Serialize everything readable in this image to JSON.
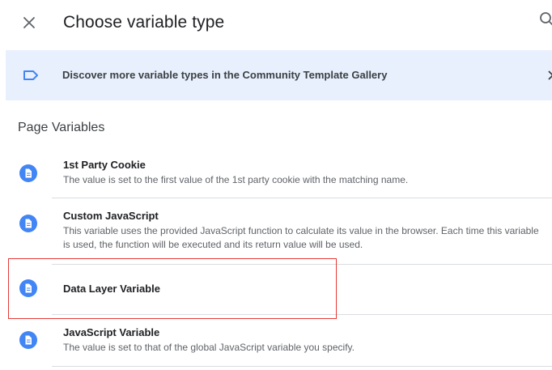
{
  "header": {
    "title": "Choose variable type",
    "close_icon": "close-icon",
    "search_icon": "search-icon"
  },
  "banner": {
    "text": "Discover more variable types in the Community Template Gallery",
    "icon": "tag-icon",
    "chevron_icon": "chevron-right-icon"
  },
  "section": {
    "heading": "Page Variables"
  },
  "items": [
    {
      "name": "1st Party Cookie",
      "description": "The value is set to the first value of the 1st party cookie with the matching name."
    },
    {
      "name": "Custom JavaScript",
      "description": "This variable uses the provided JavaScript function to calculate its value in the browser. Each time this variable is used, the function will be executed and its return value will be used."
    },
    {
      "name": "Data Layer Variable",
      "description": ""
    },
    {
      "name": "JavaScript Variable",
      "description": "The value is set to that of the global JavaScript variable you specify."
    }
  ],
  "colors": {
    "accent": "#4285f4",
    "banner_bg": "#e8f0fe",
    "highlight": "#e53935",
    "icon_bg": "#4285f4"
  }
}
